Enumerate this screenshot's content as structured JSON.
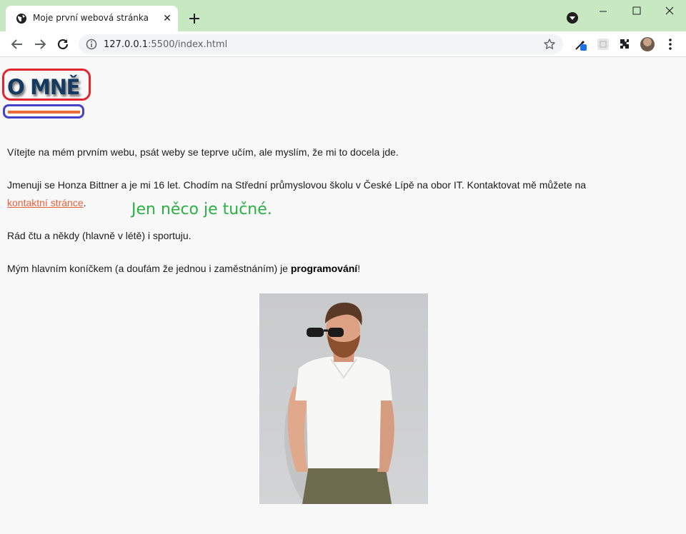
{
  "browser": {
    "tab_title": "Moje první webová stránka",
    "tab_close": "✕",
    "new_tab": "+",
    "url_host": "127.0.0.1",
    "url_port_path": ":5500/index.html"
  },
  "page": {
    "heading": "O MNĚ",
    "intro": "Vítejte na mém prvním webu, psát weby se teprve učím, ale myslím, že mi to docela jde.",
    "about_line1": "Jmenuji se Honza Bittner a je mi 16 let. Chodím na Střední průmyslovou školu v České Lípě na obor IT. Kontaktovat mě můžete na",
    "contact_link": "kontaktní stránce",
    "about_end": ".",
    "floating_note": "Jen něco je tučné.",
    "hobbies": "Rád čtu a někdy (hlavně v létě) i sportuju.",
    "main_hobby_before": "Mým hlavním koníčkem (a doufám že jednou i zaměstnáním) je ",
    "main_hobby_bold": "programování",
    "main_hobby_after": "!"
  },
  "colors": {
    "chrome_titlebar": "#c7e8c0",
    "heading": "#153a61",
    "heading_ring": "#e3262d",
    "underline_bar": "#ec6a36",
    "underline_ring": "#4342c9",
    "link": "#e8603b",
    "note": "#2bb043"
  },
  "icons": {
    "favicon": "globe-icon",
    "nav_back": "arrow-left-icon",
    "nav_forward": "arrow-right-icon",
    "nav_reload": "reload-icon",
    "site_info": "info-icon",
    "bookmark": "star-icon",
    "extensions": "puzzle-icon",
    "menu": "kebab-menu-icon"
  }
}
